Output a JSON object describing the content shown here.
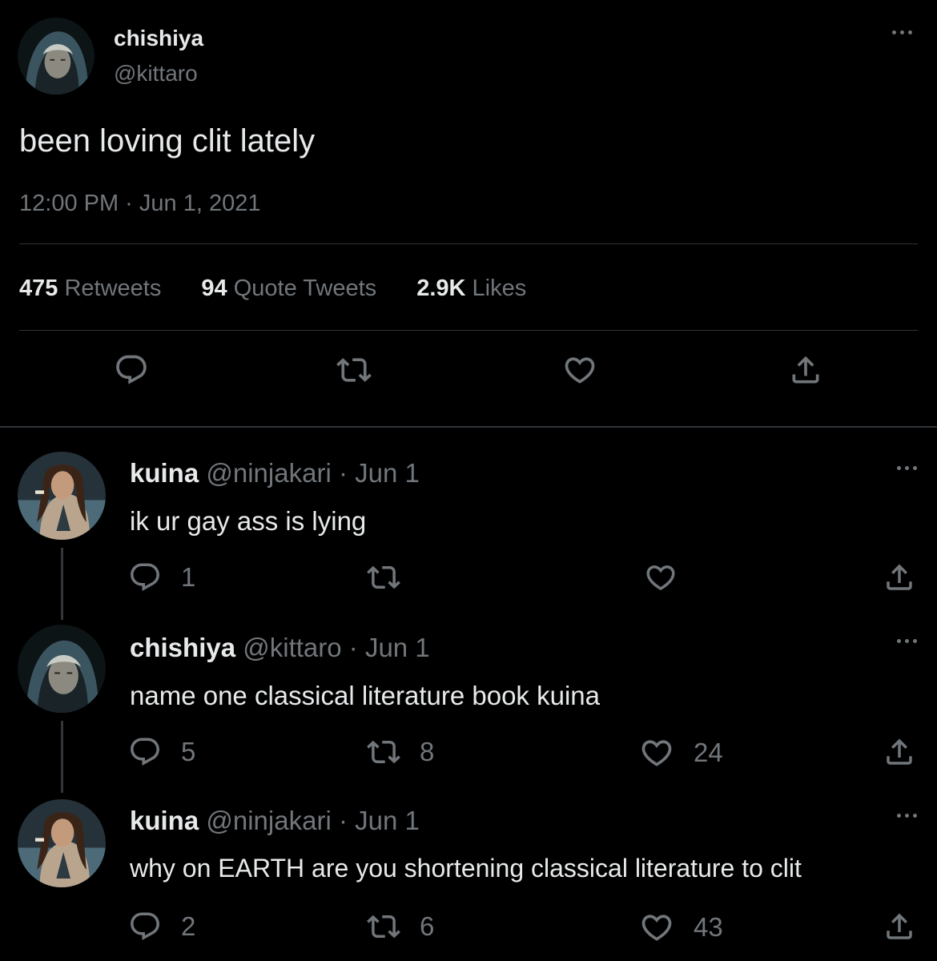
{
  "main_tweet": {
    "display_name": "chishiya",
    "handle": "@kittaro",
    "text": "been loving clit lately",
    "timestamp": "12:00 PM · Jun 1, 2021",
    "stats": {
      "retweets_count": "475",
      "retweets_label": "Retweets",
      "quotes_count": "94",
      "quotes_label": "Quote Tweets",
      "likes_count": "2.9K",
      "likes_label": "Likes"
    }
  },
  "replies": [
    {
      "display_name": "kuina",
      "handle": "@ninjakari",
      "date": "· Jun 1",
      "text": "ik ur gay ass is lying",
      "reply_count": "1",
      "retweet_count": "",
      "like_count": ""
    },
    {
      "display_name": "chishiya",
      "handle": "@kittaro",
      "date": "· Jun 1",
      "text": "name one classical literature book kuina",
      "reply_count": "5",
      "retweet_count": "8",
      "like_count": "24"
    },
    {
      "display_name": "kuina",
      "handle": "@ninjakari",
      "date": "· Jun 1",
      "text": "why on EARTH are you shortening classical literature to clit",
      "reply_count": "2",
      "retweet_count": "6",
      "like_count": "43"
    }
  ],
  "icons": {
    "reply": "reply-icon",
    "retweet": "retweet-icon",
    "like": "heart-icon",
    "share": "share-icon",
    "more": "more-icon"
  },
  "colors": {
    "background": "#000000",
    "primary_text": "#e7e9ea",
    "secondary_text": "#71767b",
    "divider": "#2f3336"
  }
}
